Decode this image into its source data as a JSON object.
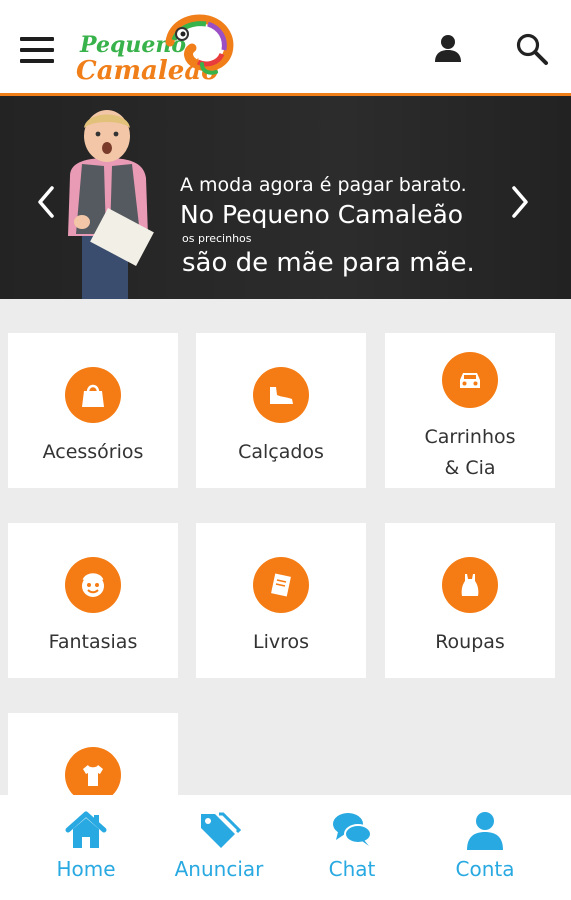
{
  "header": {
    "logo_line1": "Pequeno",
    "logo_line2": "Camaleão",
    "menu_icon": "hamburger-menu-icon",
    "user_icon": "person-icon",
    "search_icon": "search-icon",
    "accent_color": "#f07f1a"
  },
  "banner": {
    "line1": "A moda agora é pagar barato.",
    "line2": "No Pequeno Camaleão",
    "line3": "os precinhos",
    "line4": "são de mãe para mãe."
  },
  "categories": [
    {
      "label": "Acessórios",
      "icon": "shopping-bag-icon"
    },
    {
      "label": "Calçados",
      "icon": "shoe-icon"
    },
    {
      "label": "Carrinhos & Cia",
      "icon": "car-icon"
    },
    {
      "label": "Fantasias",
      "icon": "costume-face-icon"
    },
    {
      "label": "Livros",
      "icon": "book-icon"
    },
    {
      "label": "Roupas",
      "icon": "dress-icon"
    },
    {
      "label": "",
      "icon": "shirt-icon"
    }
  ],
  "bottom_nav": [
    {
      "label": "Home",
      "icon": "home-icon"
    },
    {
      "label": "Anunciar",
      "icon": "tags-icon"
    },
    {
      "label": "Chat",
      "icon": "chat-icon"
    },
    {
      "label": "Conta",
      "icon": "account-icon"
    }
  ],
  "colors": {
    "category_circle": "#f57c14",
    "nav_blue": "#29a9e1"
  }
}
